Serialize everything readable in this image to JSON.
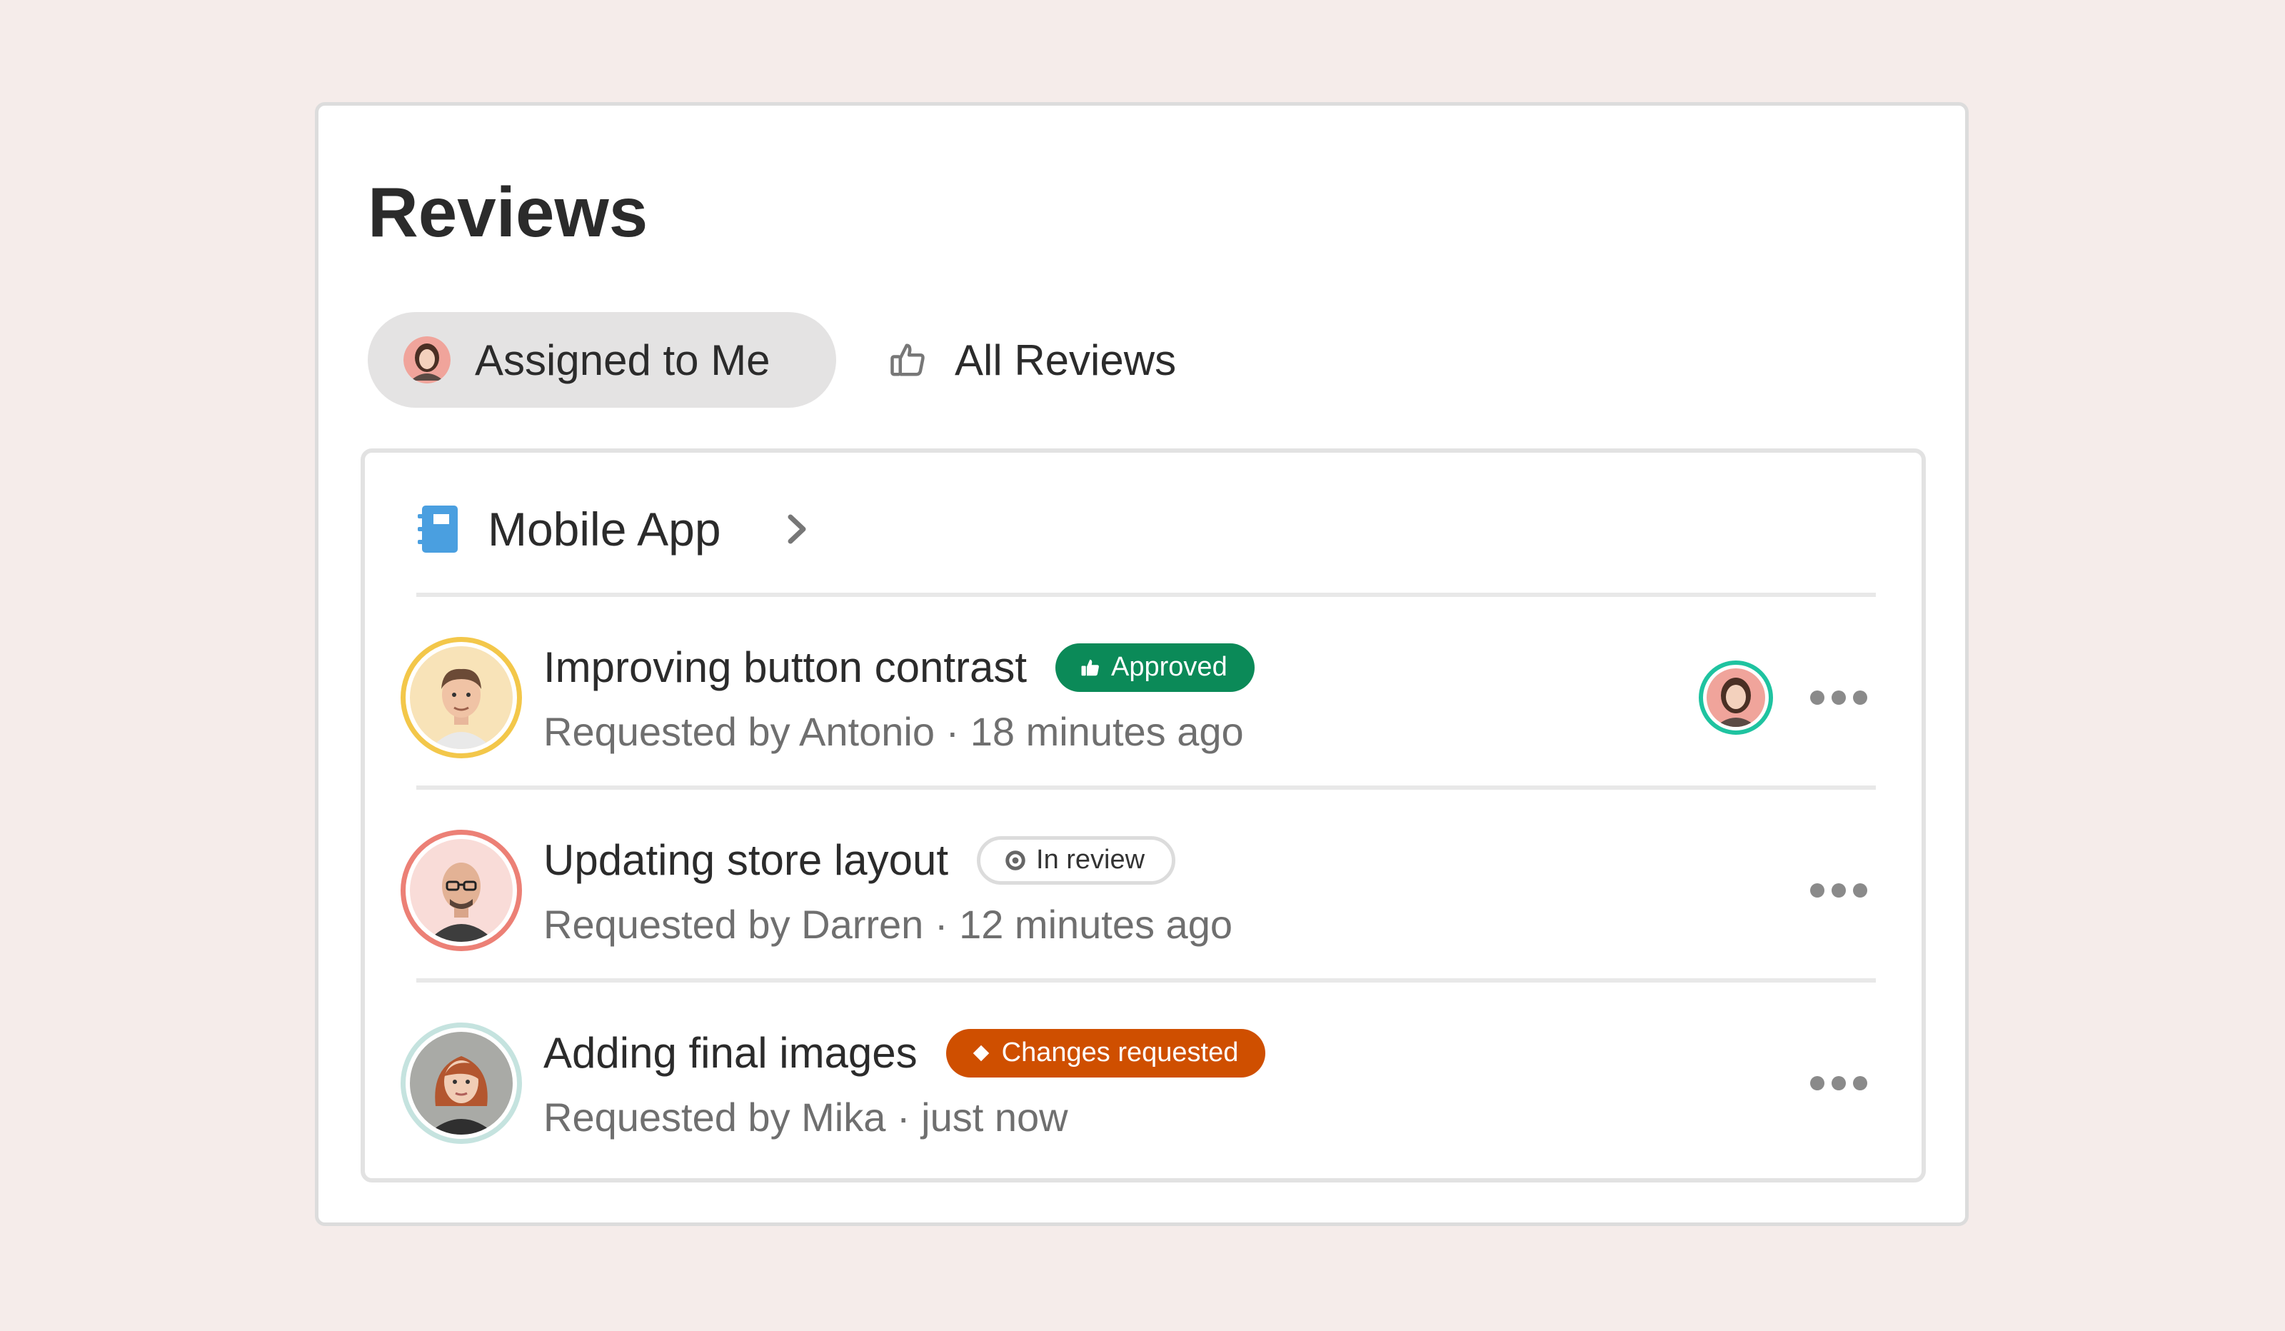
{
  "page": {
    "title": "Reviews"
  },
  "tabs": [
    {
      "label": "Assigned to Me",
      "icon": "user-avatar",
      "active": true
    },
    {
      "label": "All Reviews",
      "icon": "thumbs-up-icon",
      "active": false
    }
  ],
  "group": {
    "title": "Mobile App",
    "icon": "notebook-icon",
    "icon_color": "#4a9fe0"
  },
  "reviews": [
    {
      "title": "Improving button contrast",
      "status": "Approved",
      "status_icon": "thumbs-up-icon",
      "status_color": "#0b8a58",
      "requested": "Requested by Antonio · 18 minutes ago",
      "ring_color": "#f3c74a",
      "has_assignee": true
    },
    {
      "title": "Updating store layout",
      "status": "In review",
      "status_icon": "target-icon",
      "status_color": "#dcdcdc",
      "requested": "Requested by Darren · 12 minutes ago",
      "ring_color": "#ec8076",
      "has_assignee": false
    },
    {
      "title": "Adding final images",
      "status": "Changes requested",
      "status_icon": "diamond-icon",
      "status_color": "#cf4f00",
      "requested": "Requested by Mika · just now",
      "ring_color": "#c5e3df",
      "has_assignee": false
    }
  ]
}
